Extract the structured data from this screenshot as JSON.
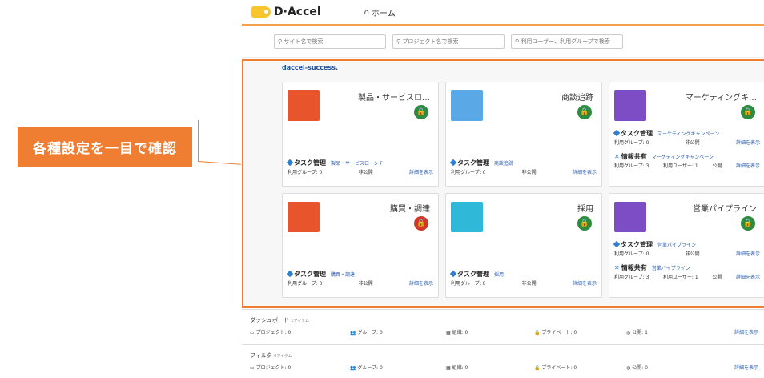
{
  "callout": {
    "text": "各種設定を一目で確認"
  },
  "header": {
    "logo": "D·Accel",
    "home": "ホーム"
  },
  "search": [
    {
      "placeholder": "サイト名で検索"
    },
    {
      "placeholder": "プロジェクト名で検索"
    },
    {
      "placeholder": "利用ユーザー、利用グループで検索"
    }
  ],
  "org_name": "daccel-success.",
  "cards": [
    {
      "title": "製品・サービスロ…",
      "lock": "green",
      "icon_color": "#e8542b",
      "apps": [
        {
          "name": "タスク管理",
          "project": "製品・サービスローンチ",
          "groups": "利用グループ: 0",
          "visibility": "非公開",
          "detail": "詳細を表示"
        }
      ]
    },
    {
      "title": "商談追跡",
      "lock": "green",
      "icon_color": "#5aa9e6",
      "apps": [
        {
          "name": "タスク管理",
          "project": "商談追跡",
          "groups": "利用グループ: 0",
          "visibility": "非公開",
          "detail": "詳細を表示"
        }
      ]
    },
    {
      "title": "マーケティングキ…",
      "lock": "green",
      "icon_color": "#7c4dc4",
      "apps": [
        {
          "name": "タスク管理",
          "project": "マーケティングキャンペーン",
          "groups": "利用グループ: 0",
          "visibility": "非公開",
          "detail": "詳細を表示"
        },
        {
          "name": "情報共有",
          "project": "マーケティングキャンペーン",
          "groups": "利用グループ: 3",
          "users": "利用ユーザー: 1",
          "visibility": "公開",
          "detail": "詳細を表示"
        }
      ]
    },
    {
      "title": "購買・調達",
      "lock": "red",
      "icon_color": "#e8542b",
      "apps": [
        {
          "name": "タスク管理",
          "project": "購買・調達",
          "groups": "利用グループ: 0",
          "visibility": "非公開",
          "detail": "詳細を表示"
        }
      ]
    },
    {
      "title": "採用",
      "lock": "green",
      "icon_color": "#2fb8d8",
      "apps": [
        {
          "name": "タスク管理",
          "project": "採用",
          "groups": "利用グループ: 0",
          "visibility": "非公開",
          "detail": "詳細を表示"
        }
      ]
    },
    {
      "title": "営業パイプライン",
      "lock": "green",
      "icon_color": "#7c4dc4",
      "apps": [
        {
          "name": "タスク管理",
          "project": "営業パイプライン",
          "groups": "利用グループ: 0",
          "visibility": "非公開",
          "detail": "詳細を表示"
        },
        {
          "name": "情報共有",
          "project": "営業パイプライン",
          "groups": "利用グループ: 3",
          "users": "利用ユーザー: 1",
          "visibility": "公開",
          "detail": "詳細を表示"
        }
      ]
    }
  ],
  "dashboard": {
    "title": "ダッシュボード",
    "sub": "1アイテム",
    "items": [
      "プロジェクト: 0",
      "グループ: 0",
      "組織: 0",
      "プライベート: 0",
      "公開: 1",
      "詳細を表示"
    ]
  },
  "filter": {
    "title": "フィルタ",
    "sub": "0アイテム",
    "items": [
      "プロジェクト: 0",
      "グループ: 0",
      "組織: 0",
      "プライベート: 0",
      "公開: 0",
      "詳細を表示"
    ]
  }
}
